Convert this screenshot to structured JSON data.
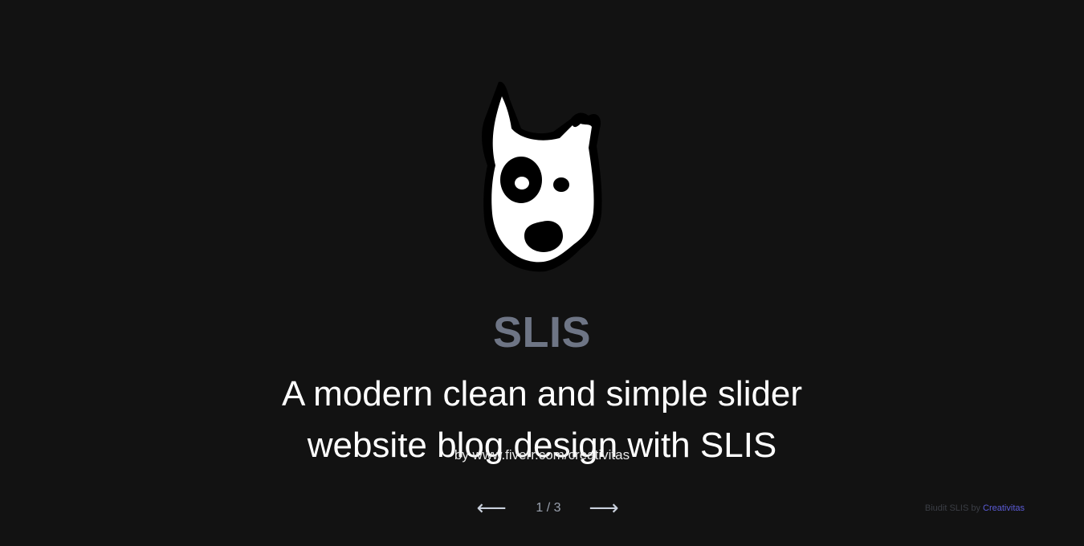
{
  "slide": {
    "brand": "SLIS",
    "headline": "A modern clean and simple slider website blog design with SLIS",
    "byline": "by www.fiverr.com/creativitas",
    "logo_icon": "dog-head-icon"
  },
  "nav": {
    "prev_label": "⟵",
    "next_label": "⟶",
    "counter": "1 / 3"
  },
  "footer": {
    "credit_text": "Biudit SLIS by",
    "credit_link": "Creativitas",
    "link_color": "#5b5bd6"
  },
  "colors": {
    "background": "#121212",
    "brand": "#6e7585",
    "text": "#ffffff"
  }
}
